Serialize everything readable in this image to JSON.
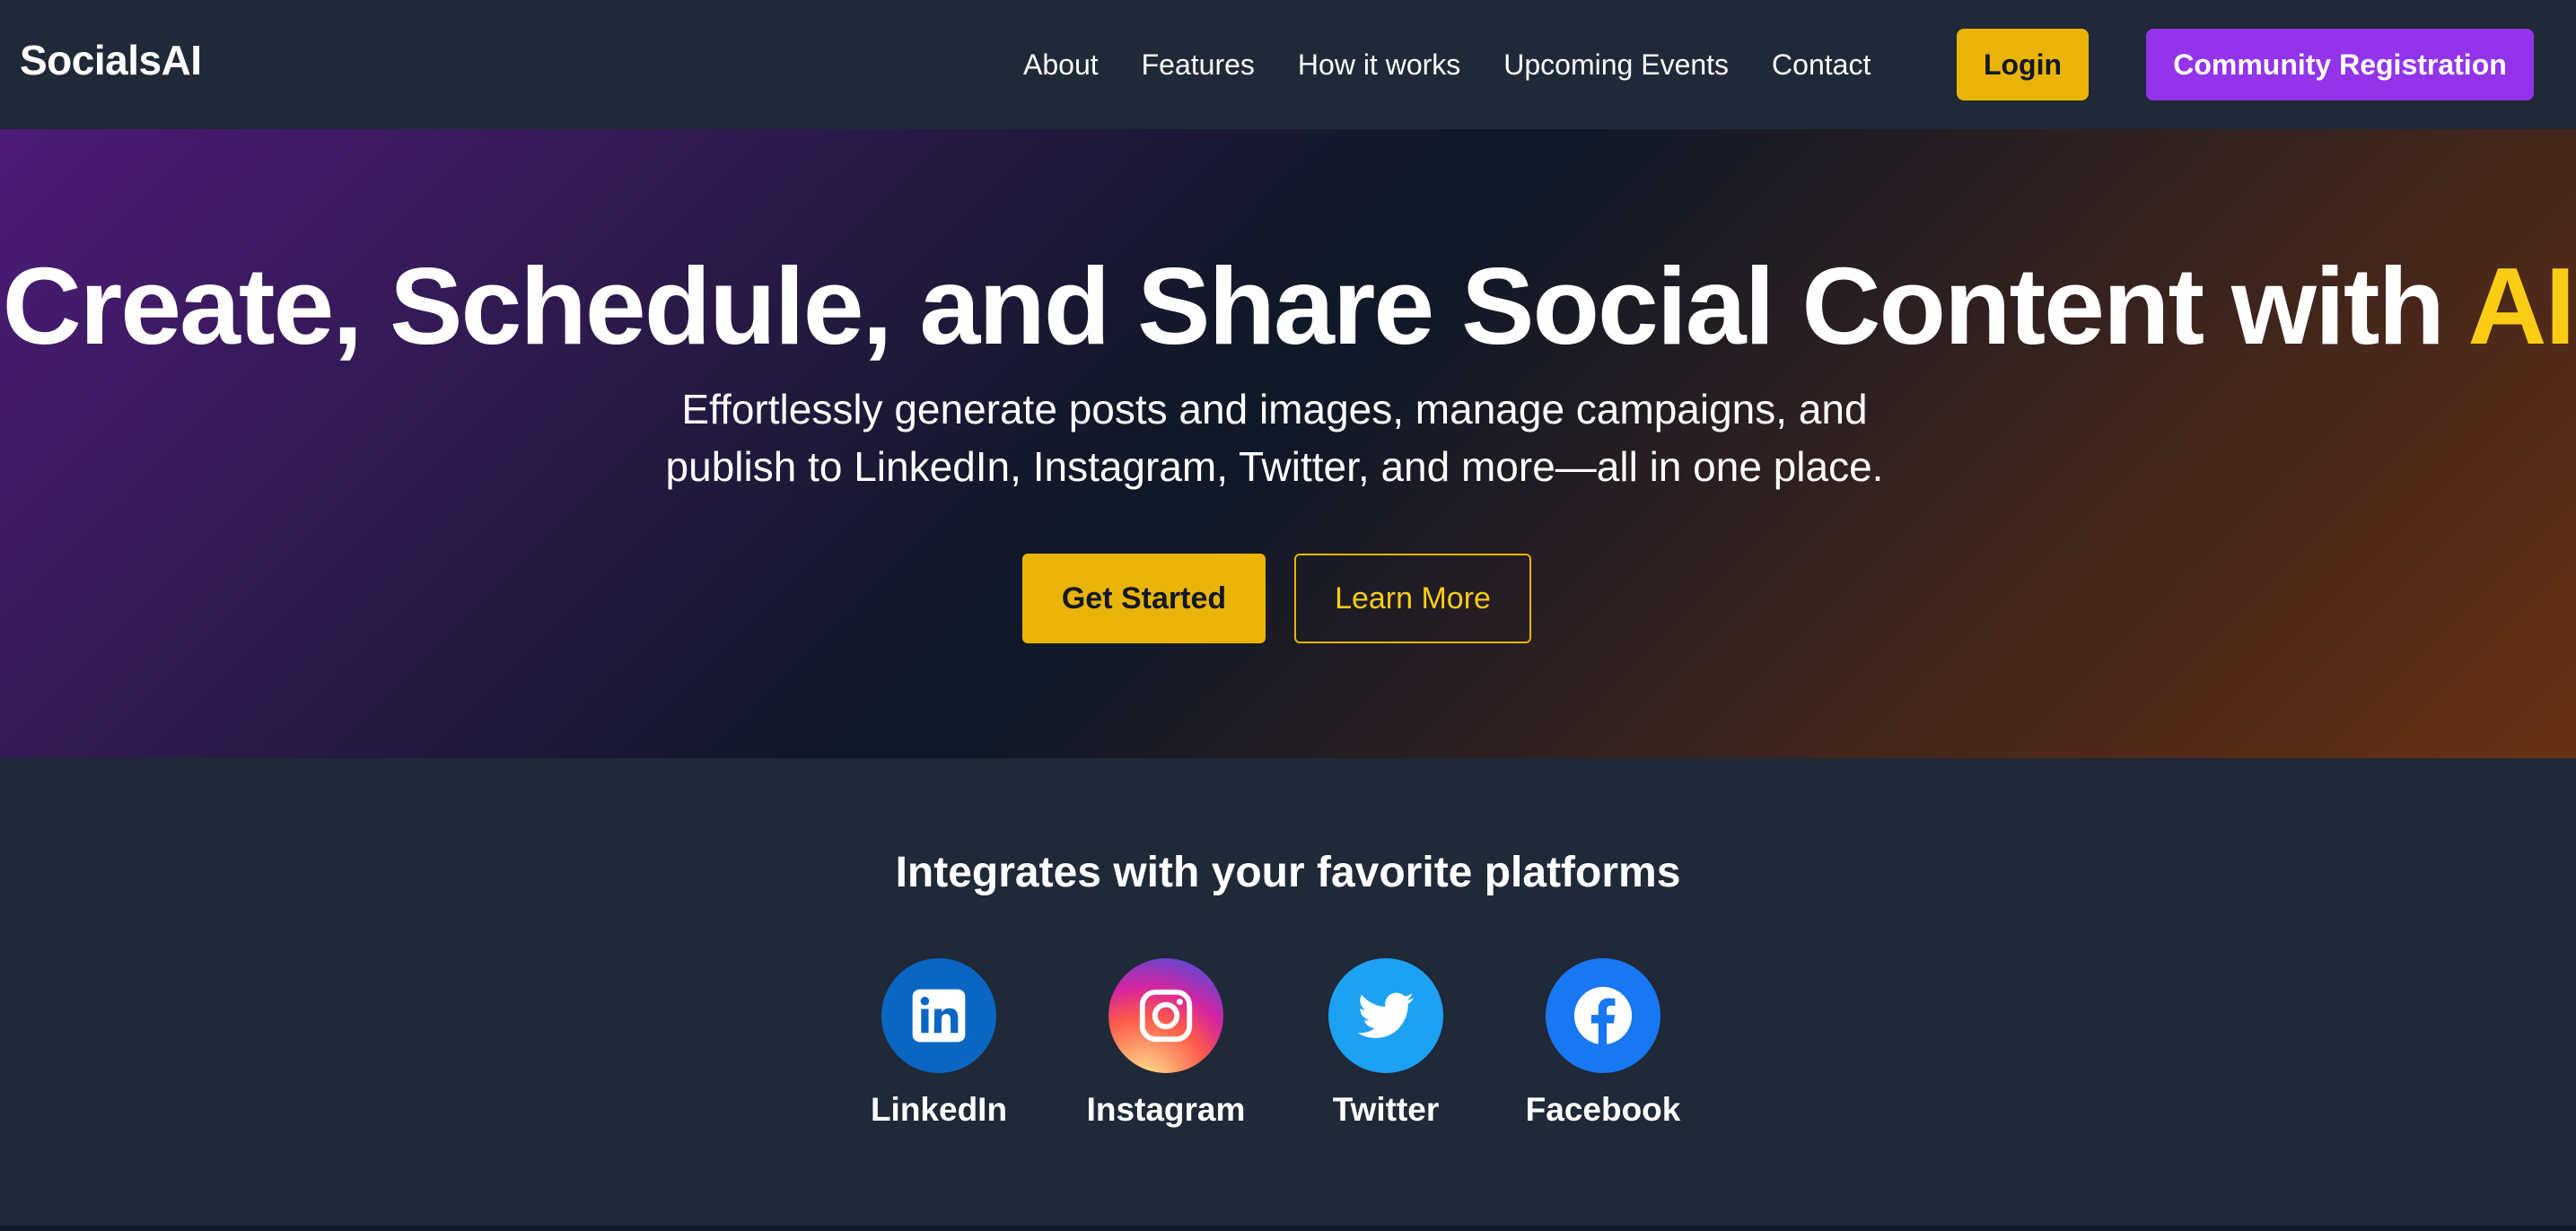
{
  "nav": {
    "brand": "SocialsAI",
    "links": [
      "About",
      "Features",
      "How it works",
      "Upcoming Events",
      "Contact"
    ],
    "login_label": "Login",
    "register_label": "Community Registration"
  },
  "hero": {
    "title_main": "Create, Schedule, and Share Social Content with ",
    "title_accent": "AI",
    "subtitle_line1": "Effortlessly generate posts and images, manage campaigns, and",
    "subtitle_line2": "publish to LinkedIn, Instagram, Twitter, and more—all in one place.",
    "primary_cta": "Get Started",
    "secondary_cta": "Learn More"
  },
  "integrations": {
    "title": "Integrates with your favorite platforms",
    "platforms": [
      {
        "name": "LinkedIn",
        "icon": "linkedin-icon",
        "color": "#0a66c2"
      },
      {
        "name": "Instagram",
        "icon": "instagram-icon",
        "color": "#e1306c"
      },
      {
        "name": "Twitter",
        "icon": "twitter-icon",
        "color": "#1da1f2"
      },
      {
        "name": "Facebook",
        "icon": "facebook-icon",
        "color": "#1877f2"
      }
    ]
  },
  "colors": {
    "accent_yellow": "#eab308",
    "accent_purple": "#9333ea",
    "background": "#1f2937"
  }
}
